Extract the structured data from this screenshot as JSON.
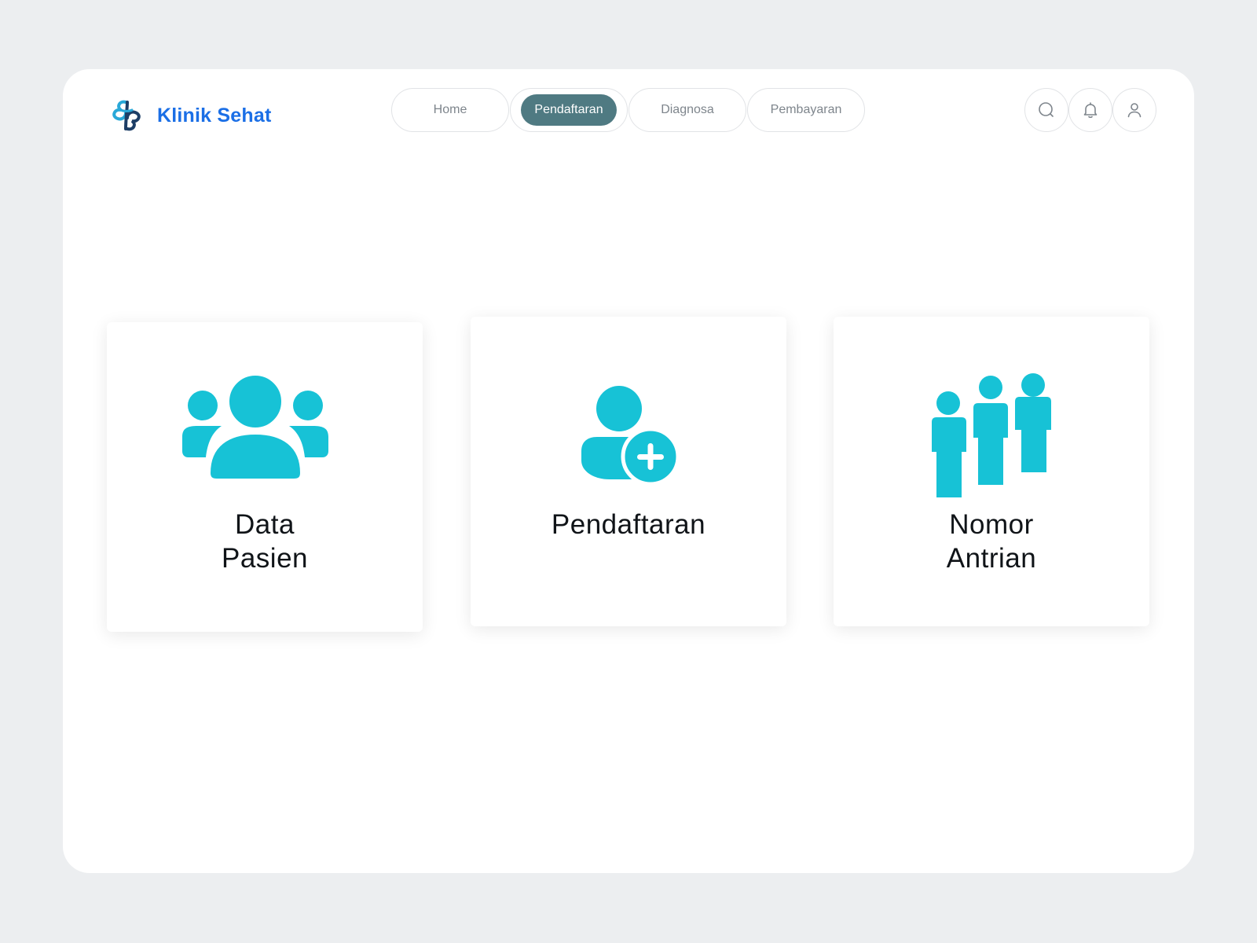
{
  "app": {
    "name": "Klinik Sehat",
    "brand_color": "#1b6fe6",
    "logo_icon": "medical-cross-logo"
  },
  "nav": {
    "tabs": [
      {
        "label": "Home",
        "active": false
      },
      {
        "label": "Pendaftaran",
        "active": true
      },
      {
        "label": "Diagnosa",
        "active": false
      },
      {
        "label": "Pembayaran",
        "active": false
      }
    ],
    "active_color": "#4f7a82"
  },
  "header_actions": [
    {
      "icon": "search-icon"
    },
    {
      "icon": "bell-icon"
    },
    {
      "icon": "user-icon"
    }
  ],
  "cards": [
    {
      "title_lines": [
        "Data",
        "Pasien"
      ],
      "icon": "patients-group-icon"
    },
    {
      "title_lines": [
        "Pendaftaran"
      ],
      "icon": "add-user-icon"
    },
    {
      "title_lines": [
        "Nomor",
        "Antrian"
      ],
      "icon": "queue-people-icon"
    }
  ],
  "colors": {
    "icon_accent": "#17c2d6",
    "page_background": "#eceef0",
    "card_background": "#ffffff"
  }
}
